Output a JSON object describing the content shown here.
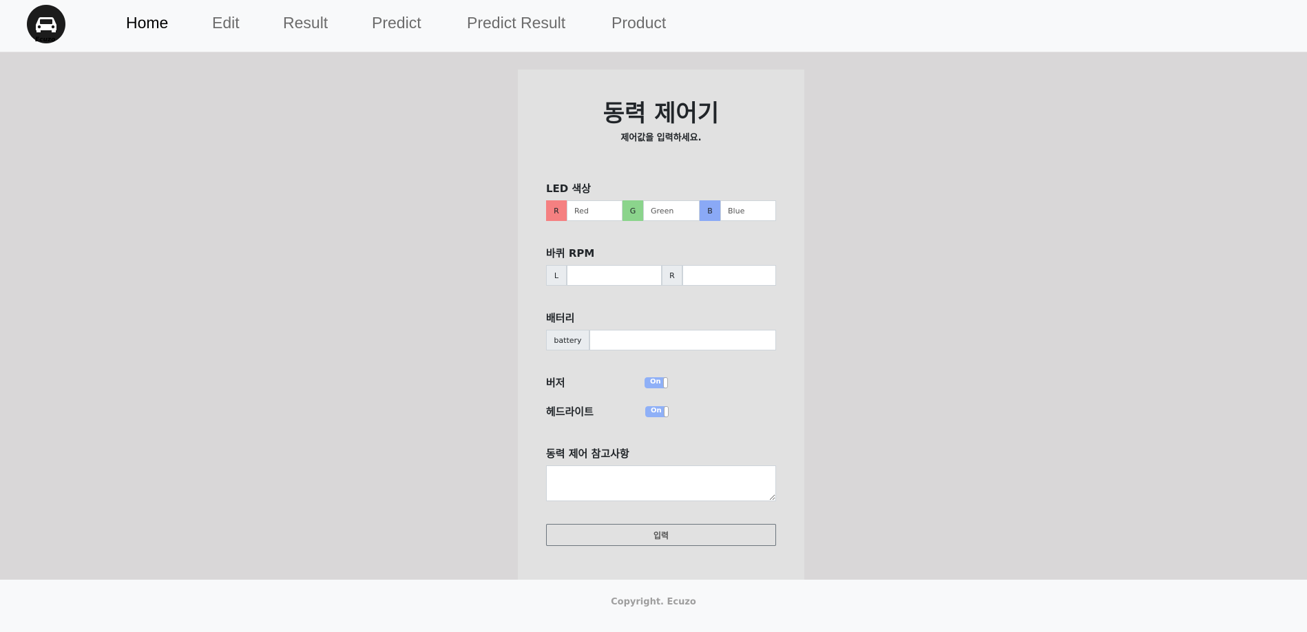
{
  "nav": {
    "logo_text": "Ecuzo",
    "links": [
      "Home",
      "Edit",
      "Result",
      "Predict",
      "Predict Result",
      "Product"
    ]
  },
  "form": {
    "title": "동력 제어기",
    "subtitle": "제어값을 입력하세요.",
    "led": {
      "label": "LED 색상",
      "r_addon": "R",
      "r_placeholder": "Red",
      "g_addon": "G",
      "g_placeholder": "Green",
      "b_addon": "B",
      "b_placeholder": "Blue"
    },
    "rpm": {
      "label": "바퀴 RPM",
      "l_addon": "L",
      "r_addon": "R"
    },
    "battery": {
      "label": "배터리",
      "addon": "battery"
    },
    "buzzer": {
      "label": "버저",
      "toggle": "On"
    },
    "headlight": {
      "label": "헤드라이트",
      "toggle": "On"
    },
    "notes": {
      "label": "동력 제어 참고사항"
    },
    "submit_label": "입력"
  },
  "footer": {
    "text": "Copyright. Ecuzo"
  },
  "colors": {
    "red_addon": "#f58081",
    "green_addon": "#8bd48c",
    "blue_addon": "#8aa9f6",
    "toggle_on": "#8fb0f7"
  }
}
